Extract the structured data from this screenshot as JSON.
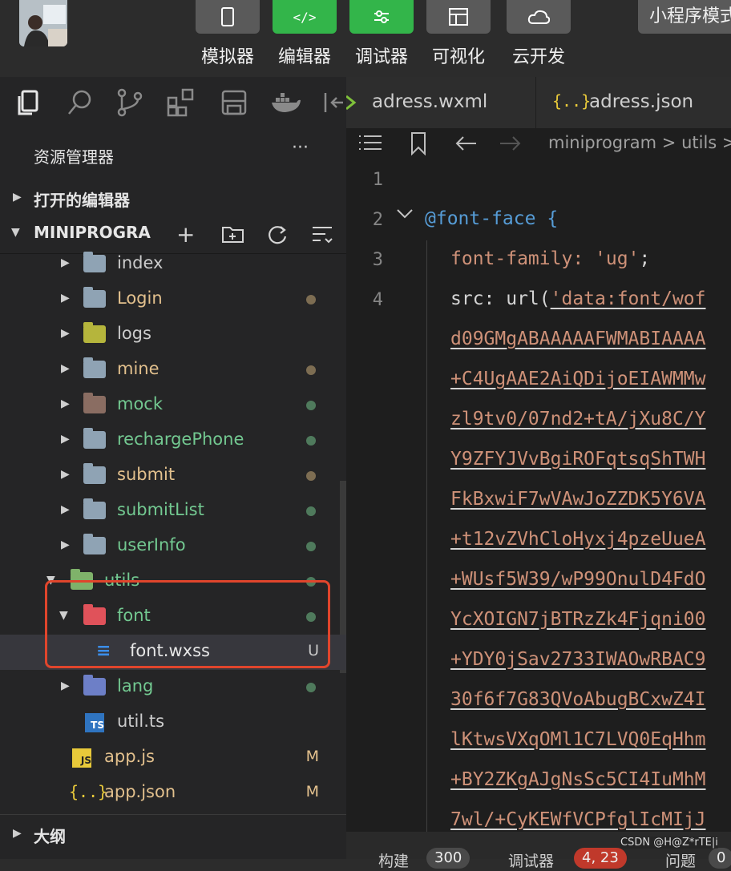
{
  "toolbar": {
    "tools": [
      {
        "label": "模拟器",
        "icon": "phone-icon",
        "active": false
      },
      {
        "label": "编辑器",
        "icon": "code-icon",
        "active": true
      },
      {
        "label": "调试器",
        "icon": "sliders-icon",
        "active": true
      },
      {
        "label": "可视化",
        "icon": "layout-icon",
        "active": false
      },
      {
        "label": "云开发",
        "icon": "cloud-icon",
        "active": false
      }
    ],
    "mini_program_label": "小程序模式"
  },
  "explorer": {
    "title": "资源管理器",
    "more": "···",
    "open_editors": "打开的编辑器",
    "project": "MINIPROGRA",
    "outline": "大纲"
  },
  "tree": [
    {
      "name": "index",
      "color": "#cccccc",
      "status": ""
    },
    {
      "name": "Login",
      "color": "#e2c08d",
      "status": "modified"
    },
    {
      "name": "logs",
      "color": "#cccccc",
      "status": ""
    },
    {
      "name": "mine",
      "color": "#e2c08d",
      "status": "modified"
    },
    {
      "name": "mock",
      "color": "#73c991",
      "status": "untracked"
    },
    {
      "name": "rechargePhone",
      "color": "#73c991",
      "status": "untracked"
    },
    {
      "name": "submit",
      "color": "#e2c08d",
      "status": "modified"
    },
    {
      "name": "submitList",
      "color": "#73c991",
      "status": "untracked"
    },
    {
      "name": "userInfo",
      "color": "#73c991",
      "status": "untracked"
    },
    {
      "name": "utils",
      "color": "#73c991",
      "status": "untracked"
    },
    {
      "name": "font",
      "color": "#73c991",
      "status": "untracked"
    },
    {
      "name": "font.wxss",
      "color": "#e6e6e6",
      "status": "U"
    },
    {
      "name": "lang",
      "color": "#73c991",
      "status": "untracked"
    },
    {
      "name": "util.ts",
      "color": "#cccccc",
      "status": ""
    },
    {
      "name": "app.js",
      "color": "#e2c08d",
      "status": "M"
    },
    {
      "name": "app.json",
      "color": "#e2c08d",
      "status": "M"
    }
  ],
  "tabs": [
    {
      "label": "adress.wxml"
    },
    {
      "label": "adress.json",
      "icon_text": "{..}"
    }
  ],
  "breadcrumb": {
    "part1": "miniprogram",
    "sep": ">",
    "part2": "utils",
    "sep2": ">"
  },
  "code": {
    "line_numbers": [
      "1",
      "2",
      "3",
      "4"
    ],
    "line2": "@font-face {",
    "line3_prop": "font-family:",
    "line3_val": "'ug'",
    "line3_end": ";",
    "line4_prefix": "src: url(",
    "line4_str": "'data:font/wof",
    "base64_lines": [
      "d09GMgABAAAAAFWMABIAAAA",
      "+C4UgAAE2AiQDijoEIAWMMw",
      "zl9tv0/07nd2+tA/jXu8C/Y",
      "Y9ZFYJVvBgiROFqtsqShTWH",
      "FkBxwiF7wVAwJoZZDK5Y6VA",
      "+t12vZVhCloHyxj4pzeUueA",
      "+WUsf5W39/wP99OnulD4FdO",
      "YcXOIGN7jBTRzZk4Fjqni00",
      "+YDY0jSav2733IWAOwRBAC9",
      "30f6f7G83QVoAbugBCxwZ4I",
      "lKtwsVXqOMl1C7LVQ0EqHhm",
      "+BY2ZKgAJgNsSc5CI4IuMhM",
      "7wl/+CyKEWfVCPfglIcMIjJ"
    ]
  },
  "status": {
    "build_label": "构建",
    "build_count": "300",
    "debugger_label": "调试器",
    "debugger_count": "4, 23",
    "problems_label": "问题",
    "problems_count": "0",
    "watermark": "CSDN @H@Z*rTE|i"
  },
  "colors": {
    "accent_green": "#33b54a",
    "highlight_red": "#e0452c"
  }
}
